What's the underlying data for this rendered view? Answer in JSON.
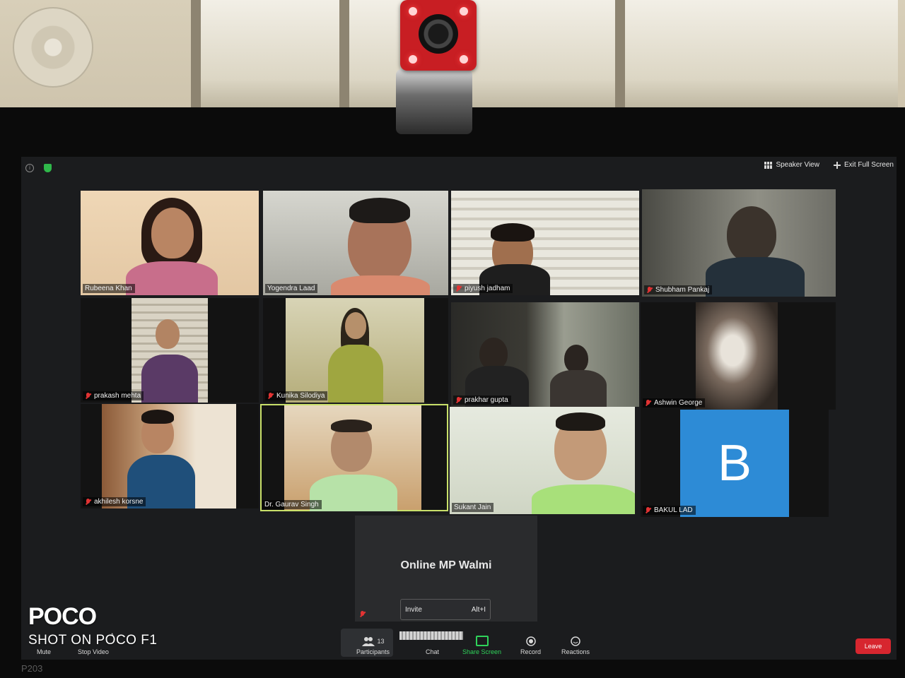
{
  "top_bar": {
    "speaker_view_label": "Speaker View",
    "exit_full_screen_label": "Exit Full Screen"
  },
  "participants": [
    {
      "name": "Rubeena Khan",
      "muted": false
    },
    {
      "name": "Yogendra Laad",
      "muted": false
    },
    {
      "name": "piyush jadham",
      "muted": true
    },
    {
      "name": "Shubham Pankaj",
      "muted": true
    },
    {
      "name": "prakash mehta",
      "muted": true
    },
    {
      "name": "Kunika Silodiya",
      "muted": true
    },
    {
      "name": "prakhar gupta",
      "muted": true
    },
    {
      "name": "Ashwin George",
      "muted": true
    },
    {
      "name": "akhilesh korsne",
      "muted": true
    },
    {
      "name": "Dr. Gaurav Singh",
      "muted": false
    },
    {
      "name": "Sukant Jain",
      "muted": false
    },
    {
      "name": "BAKUL LAD",
      "muted": true,
      "avatar_letter": "B"
    }
  ],
  "meeting_tile": {
    "name": "Online MP Walmi"
  },
  "invite_popup": {
    "label": "Invite",
    "shortcut": "Alt+I"
  },
  "toolbar": {
    "mute_label": "Mute",
    "stop_video_label": "Stop Video",
    "participants_label": "Participants",
    "participants_count": "13",
    "chat_label": "Chat",
    "share_screen_label": "Share Screen",
    "record_label": "Record",
    "reactions_label": "Reactions",
    "leave_label": "Leave"
  },
  "monitor_label": "P203",
  "watermark": {
    "brand": "POCO",
    "shot": "SHOT ON POCO F1"
  },
  "colors": {
    "leave": "#d7262f",
    "share": "#2fd35a",
    "avatar": "#2d8bd6",
    "muted": "#e23333"
  }
}
